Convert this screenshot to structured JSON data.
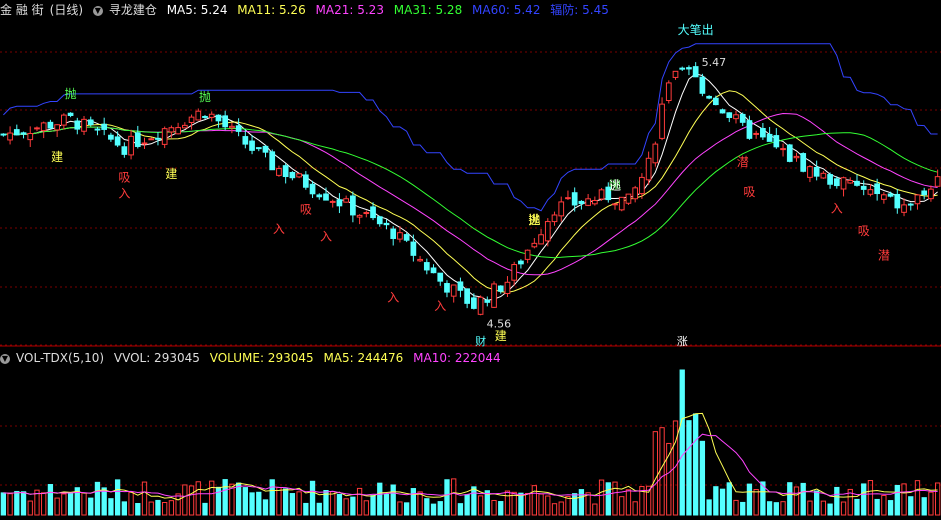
{
  "header": {
    "stock": "金 融 街",
    "period": "(日线)",
    "indicator": "寻龙建仓",
    "ma5": "MA5: 5.24",
    "ma11": "MA11: 5.26",
    "ma21": "MA21: 5.23",
    "ma31": "MA31: 5.28",
    "ma60": "MA60: 5.42",
    "extra": "辐防: 5.45"
  },
  "vol_header": {
    "name": "VOL-TDX(5,10)",
    "vvol": "VVOL: 293045",
    "volume": "VOLUME: 293045",
    "ma5": "MA5: 244476",
    "ma10": "MA10: 222044"
  },
  "colors": {
    "up": "#ff3b3b",
    "down": "#54ffff",
    "ma5": "#ffffff",
    "ma11": "#ffff55",
    "ma21": "#ff44ff",
    "ma31": "#33ff33",
    "ma60": "#3344ff",
    "grid": "#7a0000"
  },
  "chart_data": [
    {
      "type": "candlestick",
      "annotations": {
        "high_label": "5.47",
        "low_label": "4.56",
        "top_text": "大笔出",
        "ticks": [
          "财",
          "涨"
        ]
      },
      "signals": [
        {
          "t": "抛",
          "i": 10,
          "c": "#55ff55"
        },
        {
          "t": "抛",
          "i": 30,
          "c": "#55ff55"
        },
        {
          "t": "抛",
          "i": 91,
          "c": "#55ff55"
        },
        {
          "t": "抛",
          "i": 79,
          "c": "#ffff55"
        },
        {
          "t": "逃",
          "i": 79,
          "c": "#ffff55"
        },
        {
          "t": "逃",
          "i": 91,
          "c": "#ffffff"
        },
        {
          "t": "建",
          "i": 8,
          "c": "#ffff55"
        },
        {
          "t": "建",
          "i": 25,
          "c": "#ffff55"
        },
        {
          "t": "建",
          "i": 74,
          "c": "#ffff55"
        },
        {
          "t": "吸",
          "i": 18,
          "c": "#ff3b3b"
        },
        {
          "t": "入",
          "i": 18,
          "c": "#ff3b3b"
        },
        {
          "t": "入",
          "i": 41,
          "c": "#ff3b3b"
        },
        {
          "t": "吸",
          "i": 45,
          "c": "#ff3b3b"
        },
        {
          "t": "入",
          "i": 48,
          "c": "#ff3b3b"
        },
        {
          "t": "入",
          "i": 58,
          "c": "#ff3b3b"
        },
        {
          "t": "入",
          "i": 65,
          "c": "#ff3b3b"
        },
        {
          "t": "潜",
          "i": 110,
          "c": "#ff3b3b"
        },
        {
          "t": "吸",
          "i": 111,
          "c": "#ff3b3b"
        },
        {
          "t": "入",
          "i": 124,
          "c": "#ff3b3b"
        },
        {
          "t": "吸",
          "i": 128,
          "c": "#ff3b3b"
        },
        {
          "t": "潜",
          "i": 131,
          "c": "#ff3b3b"
        }
      ]
    },
    {
      "type": "bar",
      "title": "VOL-TDX(5,10)"
    }
  ]
}
